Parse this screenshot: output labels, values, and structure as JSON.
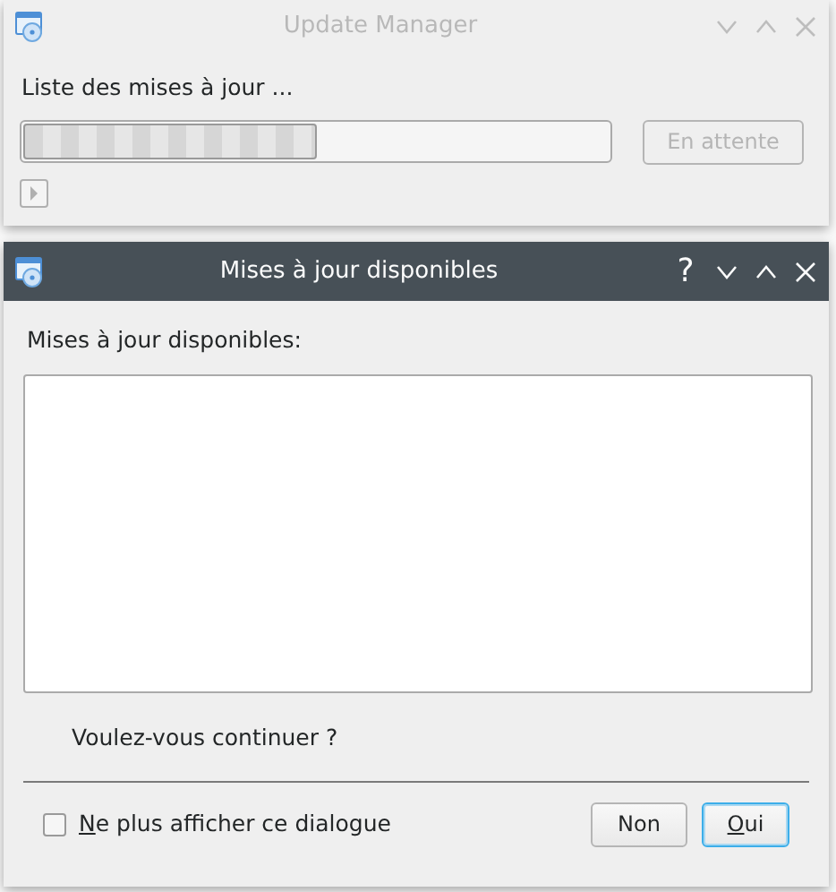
{
  "back_window": {
    "title": "Update Manager",
    "active": false,
    "status": "Liste des mises à jour ...",
    "progress": {
      "level": 0.5
    },
    "button": {
      "label": "En attente",
      "disabled": true
    },
    "title_buttons": [
      {
        "kind": "minimize"
      },
      {
        "kind": "maximize"
      },
      {
        "kind": "close"
      }
    ]
  },
  "dialog": {
    "title": "Mises à jour disponibles",
    "active": true,
    "title_buttons": [
      {
        "kind": "help",
        "label": "?"
      },
      {
        "kind": "minimize"
      },
      {
        "kind": "maximize"
      },
      {
        "kind": "close"
      }
    ],
    "list_label": "Mises à jour disponibles:",
    "question": "Voulez-vous continuer ?",
    "checkbox": {
      "label": "Ne plus afficher ce dialogue",
      "mnemonic": true,
      "checked": false
    },
    "buttons": [
      {
        "label": "Non",
        "mnemonic": false,
        "default": false
      },
      {
        "label": "Oui",
        "mnemonic": true,
        "default": true
      }
    ]
  }
}
